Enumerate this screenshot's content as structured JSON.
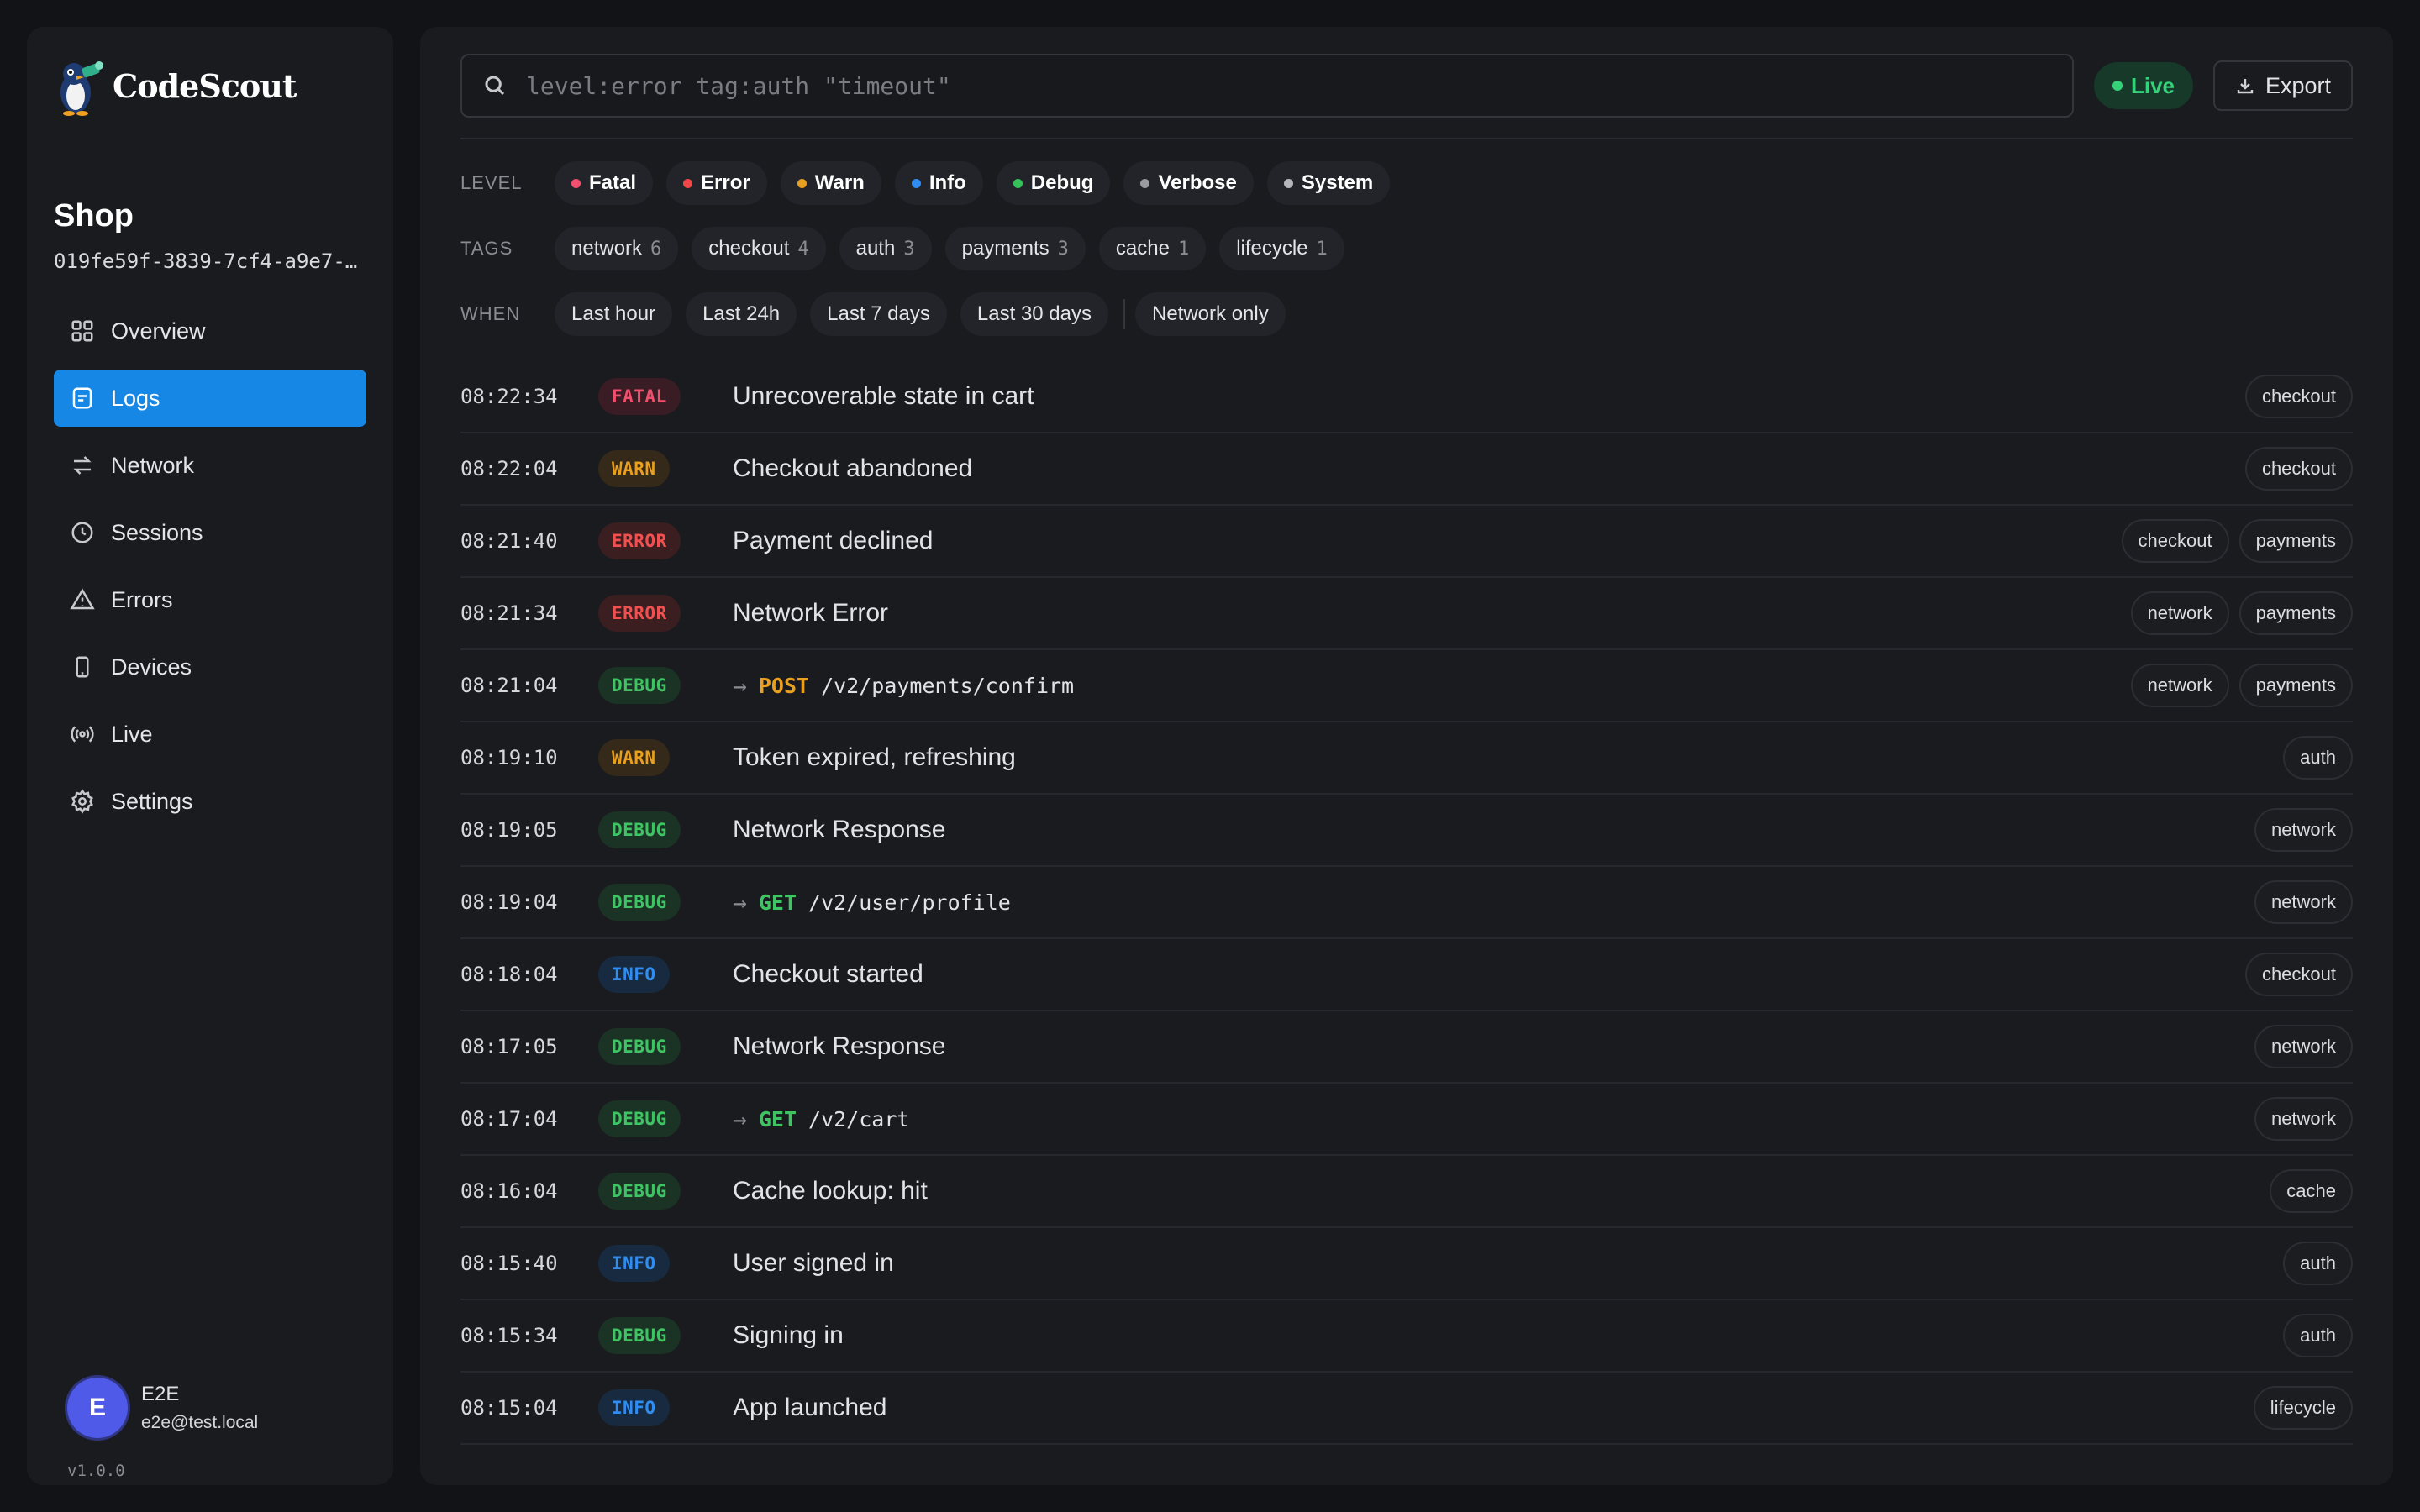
{
  "brand": {
    "name": "CodeScout"
  },
  "project": {
    "name": "Shop",
    "id": "019fe59f-3839-7cf4-a9e7-…"
  },
  "nav": [
    {
      "label": "Overview",
      "icon": "grid-icon",
      "active": false
    },
    {
      "label": "Logs",
      "icon": "document-icon",
      "active": true
    },
    {
      "label": "Network",
      "icon": "arrows-icon",
      "active": false
    },
    {
      "label": "Sessions",
      "icon": "clock-icon",
      "active": false
    },
    {
      "label": "Errors",
      "icon": "warning-icon",
      "active": false
    },
    {
      "label": "Devices",
      "icon": "phone-icon",
      "active": false
    },
    {
      "label": "Live",
      "icon": "broadcast-icon",
      "active": false
    },
    {
      "label": "Settings",
      "icon": "gear-icon",
      "active": false
    }
  ],
  "user": {
    "initial": "E",
    "name": "E2E",
    "email": "e2e@test.local"
  },
  "version": "v1.0.0",
  "search": {
    "placeholder": "level:error tag:auth \"timeout\"",
    "value": ""
  },
  "toolbar": {
    "live_label": "Live",
    "export_label": "Export"
  },
  "filters": {
    "level_label": "LEVEL",
    "levels": [
      {
        "label": "Fatal",
        "color": "#f0506e"
      },
      {
        "label": "Error",
        "color": "#f04848"
      },
      {
        "label": "Warn",
        "color": "#e8a020"
      },
      {
        "label": "Info",
        "color": "#2f8cf0"
      },
      {
        "label": "Debug",
        "color": "#36c25a"
      },
      {
        "label": "Verbose",
        "color": "#9a9ca2"
      },
      {
        "label": "System",
        "color": "#b4b6bb"
      }
    ],
    "tags_label": "TAGS",
    "tags": [
      {
        "label": "network",
        "count": "6"
      },
      {
        "label": "checkout",
        "count": "4"
      },
      {
        "label": "auth",
        "count": "3"
      },
      {
        "label": "payments",
        "count": "3"
      },
      {
        "label": "cache",
        "count": "1"
      },
      {
        "label": "lifecycle",
        "count": "1"
      }
    ],
    "when_label": "WHEN",
    "when": [
      "Last hour",
      "Last 24h",
      "Last 7 days",
      "Last 30 days"
    ],
    "network_only": "Network only"
  },
  "level_colors": {
    "FATAL": {
      "fg": "#f0506e",
      "bg": "#3a1c25"
    },
    "ERROR": {
      "fg": "#f05050",
      "bg": "#3a1e20"
    },
    "WARN": {
      "fg": "#e8a020",
      "bg": "#35291a"
    },
    "DEBUG": {
      "fg": "#3ec462",
      "bg": "#1b3325"
    },
    "INFO": {
      "fg": "#2f8cf0",
      "bg": "#182a40"
    }
  },
  "method_colors": {
    "POST": "#e8a020",
    "GET": "#3ec462"
  },
  "logs": [
    {
      "time": "08:22:34",
      "level": "FATAL",
      "message": "Unrecoverable state in cart",
      "tags": [
        "checkout"
      ]
    },
    {
      "time": "08:22:04",
      "level": "WARN",
      "message": "Checkout abandoned",
      "tags": [
        "checkout"
      ]
    },
    {
      "time": "08:21:40",
      "level": "ERROR",
      "message": "Payment declined",
      "tags": [
        "checkout",
        "payments"
      ]
    },
    {
      "time": "08:21:34",
      "level": "ERROR",
      "message": "Network Error",
      "tags": [
        "network",
        "payments"
      ]
    },
    {
      "time": "08:21:04",
      "level": "DEBUG",
      "method": "POST",
      "path": "/v2/payments/confirm",
      "tags": [
        "network",
        "payments"
      ]
    },
    {
      "time": "08:19:10",
      "level": "WARN",
      "message": "Token expired, refreshing",
      "tags": [
        "auth"
      ]
    },
    {
      "time": "08:19:05",
      "level": "DEBUG",
      "message": "Network Response",
      "tags": [
        "network"
      ]
    },
    {
      "time": "08:19:04",
      "level": "DEBUG",
      "method": "GET",
      "path": "/v2/user/profile",
      "tags": [
        "network"
      ]
    },
    {
      "time": "08:18:04",
      "level": "INFO",
      "message": "Checkout started",
      "tags": [
        "checkout"
      ]
    },
    {
      "time": "08:17:05",
      "level": "DEBUG",
      "message": "Network Response",
      "tags": [
        "network"
      ]
    },
    {
      "time": "08:17:04",
      "level": "DEBUG",
      "method": "GET",
      "path": "/v2/cart",
      "tags": [
        "network"
      ]
    },
    {
      "time": "08:16:04",
      "level": "DEBUG",
      "message": "Cache lookup: hit",
      "tags": [
        "cache"
      ]
    },
    {
      "time": "08:15:40",
      "level": "INFO",
      "message": "User signed in",
      "tags": [
        "auth"
      ]
    },
    {
      "time": "08:15:34",
      "level": "DEBUG",
      "message": "Signing in",
      "tags": [
        "auth"
      ]
    },
    {
      "time": "08:15:04",
      "level": "INFO",
      "message": "App launched",
      "tags": [
        "lifecycle"
      ]
    }
  ]
}
